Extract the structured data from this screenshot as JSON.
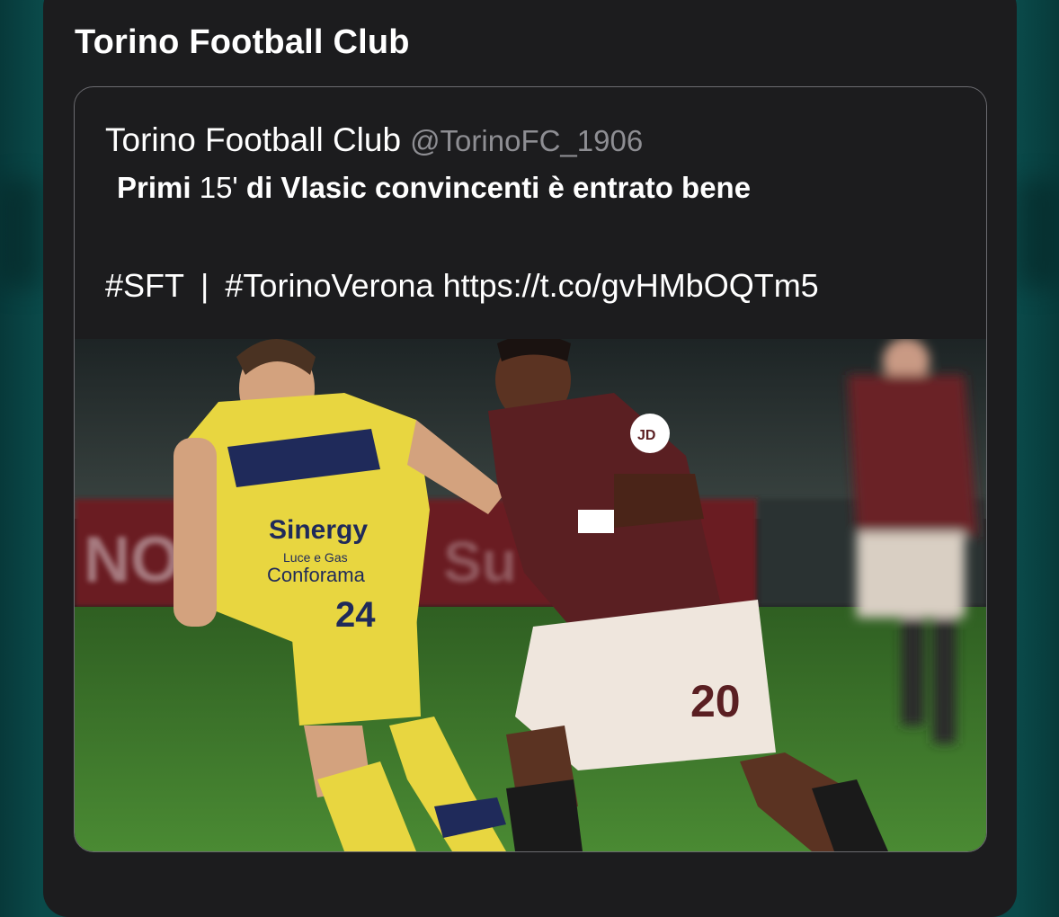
{
  "sheet": {
    "title": "Torino Football Club"
  },
  "tweet": {
    "author_name": "Torino Football Club",
    "author_handle": "@TorinoFC_1906",
    "text_part1": "Primi",
    "text_number": "15'",
    "text_part2": "di Vlasic convincenti è entrato bene",
    "hashtag1": "#SFT",
    "separator": "|",
    "hashtag2": "#TorinoVerona",
    "link": "https://t.co/gvHMbOQTm5"
  },
  "photo": {
    "description": "football-match-photo",
    "number_yellow": "24",
    "number_maroon": "20",
    "sponsor_text1": "Sinergy",
    "sponsor_text2": "Luce e Gas",
    "sponsor_text3": "Conforama",
    "colors": {
      "yellow_kit": "#e8d640",
      "maroon_kit": "#5a1f22",
      "pitch": "#3d7a2a"
    }
  }
}
